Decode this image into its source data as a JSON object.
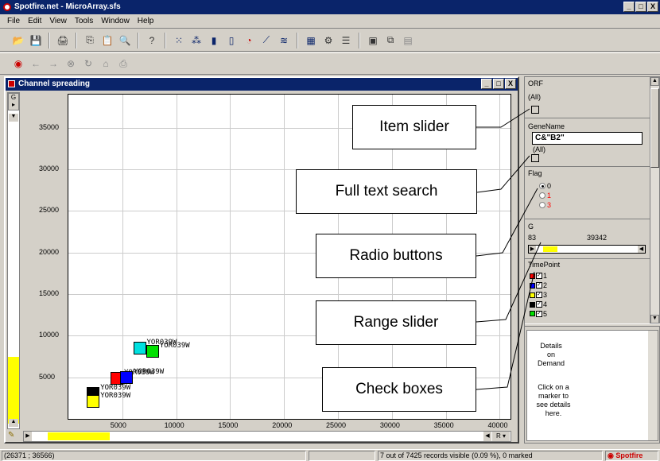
{
  "window": {
    "title": "Spotfire.net - MicroArray.sfs",
    "min": "_",
    "max": "□",
    "close": "X"
  },
  "menu": [
    "File",
    "Edit",
    "View",
    "Tools",
    "Window",
    "Help"
  ],
  "chart_window": {
    "title": "Channel spreading",
    "left_axis_button": "G",
    "bottom_axis_button": "R"
  },
  "chart_data": {
    "type": "scatter",
    "xlim": [
      0,
      41000
    ],
    "ylim": [
      0,
      39000
    ],
    "x_ticks": [
      5000,
      10000,
      15000,
      20000,
      25000,
      30000,
      35000,
      40000
    ],
    "y_ticks": [
      5000,
      10000,
      15000,
      20000,
      25000,
      30000,
      35000
    ],
    "grid": true,
    "points": [
      {
        "label": "YOR039W",
        "x": 6600,
        "y": 8500,
        "color": "#00e0e0"
      },
      {
        "label": "YOR039W",
        "x": 7800,
        "y": 8100,
        "color": "#00e000"
      },
      {
        "label": "YOR039W",
        "x": 4500,
        "y": 4900,
        "color": "#ff0000"
      },
      {
        "label": "YOR039W",
        "x": 5400,
        "y": 5000,
        "color": "#0000ff"
      },
      {
        "label": "YOR039W",
        "x": 2300,
        "y": 3100,
        "color": "#000000"
      },
      {
        "label": "YOR039W",
        "x": 2300,
        "y": 2100,
        "color": "#ffff00"
      }
    ]
  },
  "query_devices": {
    "orf_label": "ORF",
    "orf_value": "(All)",
    "genename_label": "GeneName",
    "genename_value": "C&\"B2\"",
    "genename_all": "(All)",
    "flag_label": "Flag",
    "flag_options": [
      {
        "label": "0",
        "color": "#000000",
        "selected": true
      },
      {
        "label": "1",
        "color": "#ff0000",
        "selected": false
      },
      {
        "label": "3",
        "color": "#ff0000",
        "selected": false
      }
    ],
    "g_label": "G",
    "g_min": "83",
    "g_max": "39342",
    "timepoint_label": "TimePoint",
    "timepoints": [
      {
        "label": "1",
        "color": "#ff0000"
      },
      {
        "label": "2",
        "color": "#0000ff"
      },
      {
        "label": "3",
        "color": "#ffff00"
      },
      {
        "label": "4",
        "color": "#000000"
      },
      {
        "label": "5",
        "color": "#00e000"
      }
    ]
  },
  "details": {
    "title_line1": "Details",
    "title_line2": "on",
    "title_line3": "Demand",
    "hint_line1": "Click on a",
    "hint_line2": "marker to",
    "hint_line3": "see details",
    "hint_line4": "here."
  },
  "callouts": [
    "Item slider",
    "Full text search",
    "Radio buttons",
    "Range slider",
    "Check boxes"
  ],
  "status": {
    "coords": "(26371 ; 36566)",
    "records": "7 out of 7425 records visible (0.09 %), 0 marked",
    "brand": "Spotfire"
  }
}
